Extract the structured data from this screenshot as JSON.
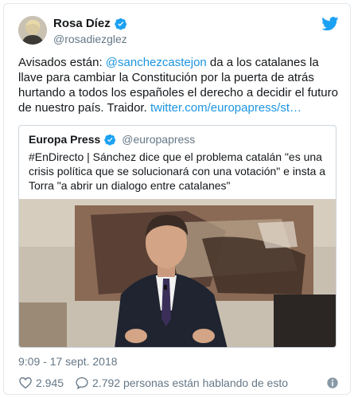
{
  "author": {
    "name": "Rosa Díez",
    "handle": "@rosadiezglez"
  },
  "tweet": {
    "text_before": "Avisados están: ",
    "mention": "@sanchezcastejon",
    "text_after": " da a los catalanes la llave para cambiar la Constitución por la puerta de atrás hurtando a todos los españoles el derecho a decidir el futuro de nuestro país. Traidor.  ",
    "link": "twitter.com/europapress/st…"
  },
  "quoted": {
    "name": "Europa Press",
    "handle": "@europapress",
    "text": "#EnDirecto | Sánchez dice que el problema catalán \"es una crisis política que se solucionará con una votación\" e insta a Torra \"a abrir un dialogo entre catalanes\""
  },
  "meta": {
    "timestamp": "9:09 - 17 sept. 2018",
    "likes": "2.945",
    "replies_text": "2.792 personas están hablando de esto"
  },
  "icons": {
    "verified": "verified-badge-icon",
    "bird": "twitter-bird-icon",
    "like": "heart-icon",
    "reply": "speech-bubble-icon",
    "info": "info-icon"
  },
  "colors": {
    "link": "#1b95e0",
    "secondary_text": "#657786",
    "verified": "#1da1f2",
    "border": "#e1e8ed"
  }
}
